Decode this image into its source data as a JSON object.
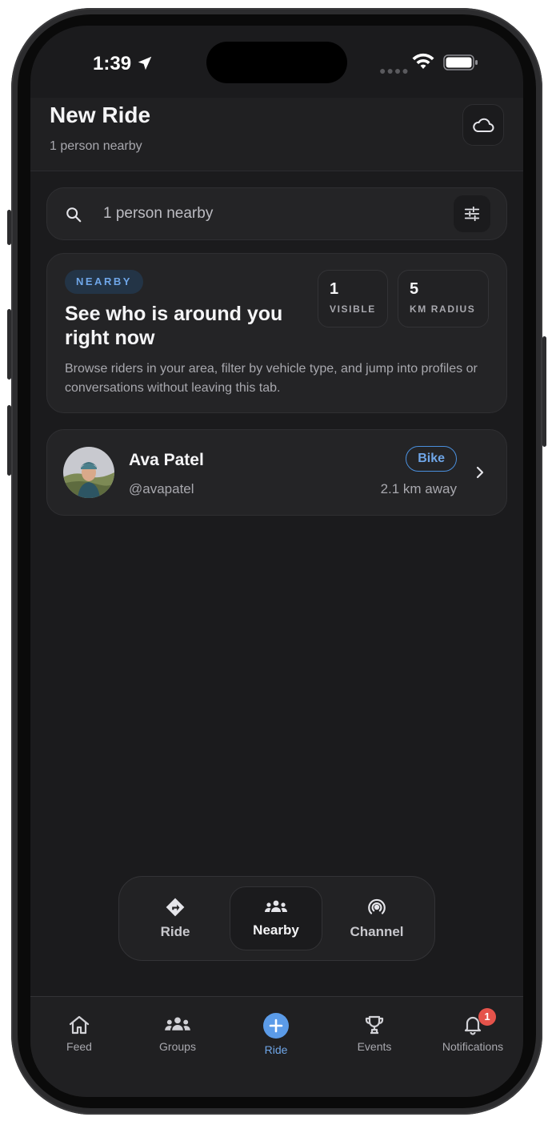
{
  "status_bar": {
    "time": "1:39"
  },
  "header": {
    "title": "New Ride",
    "subtitle": "1 person nearby",
    "cloud_icon": "cloud-icon"
  },
  "search": {
    "placeholder": "1 person nearby",
    "search_icon": "search-icon",
    "filter_icon": "sliders-icon"
  },
  "nearby_card": {
    "badge": "NEARBY",
    "headline": "See who is around you right now",
    "description": "Browse riders in your area, filter by vehicle type, and jump into profiles or conversations without leaving this tab.",
    "stats": [
      {
        "value": "1",
        "label": "VISIBLE"
      },
      {
        "value": "5",
        "label": "KM RADIUS"
      }
    ]
  },
  "riders": [
    {
      "name": "Ava Patel",
      "handle": "@avapatel",
      "vehicle": "Bike",
      "distance": "2.1 km away"
    }
  ],
  "mode_switcher": {
    "items": [
      {
        "label": "Ride",
        "icon": "directions-icon",
        "active": false
      },
      {
        "label": "Nearby",
        "icon": "people-icon",
        "active": true
      },
      {
        "label": "Channel",
        "icon": "broadcast-icon",
        "active": false
      }
    ]
  },
  "tab_bar": {
    "items": [
      {
        "label": "Feed",
        "icon": "home-icon"
      },
      {
        "label": "Groups",
        "icon": "groups-icon"
      },
      {
        "label": "Ride",
        "icon": "plus-circle-icon",
        "active": true
      },
      {
        "label": "Events",
        "icon": "trophy-icon"
      },
      {
        "label": "Notifications",
        "icon": "bell-icon",
        "badge": "1"
      }
    ]
  },
  "colors": {
    "accent": "#6fa6e8",
    "background": "#1b1b1d",
    "card": "#242426",
    "badge_red": "#e5534b"
  }
}
